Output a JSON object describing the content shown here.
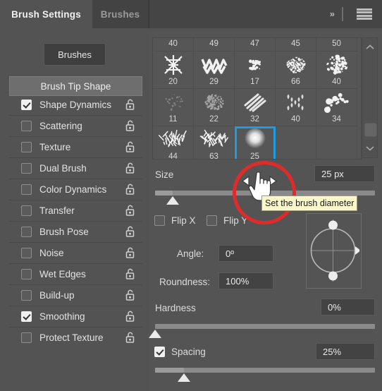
{
  "window": {
    "tabs": [
      {
        "label": "Brush Settings",
        "active": true
      },
      {
        "label": "Brushes",
        "active": false
      }
    ],
    "expand_icon": "chevron-double-right-icon",
    "menu_icon": "hamburger-menu-icon"
  },
  "sidebar": {
    "brushes_button": "Brushes",
    "header": "Brush Tip Shape",
    "items": [
      {
        "label": "Shape Dynamics",
        "checked": true,
        "lock": "unlocked-icon"
      },
      {
        "label": "Scattering",
        "checked": false,
        "lock": "unlocked-icon"
      },
      {
        "label": "Texture",
        "checked": false,
        "lock": "unlocked-icon"
      },
      {
        "label": "Dual Brush",
        "checked": false,
        "lock": "unlocked-icon"
      },
      {
        "label": "Color Dynamics",
        "checked": false,
        "lock": "unlocked-icon"
      },
      {
        "label": "Transfer",
        "checked": false,
        "lock": "unlocked-icon"
      },
      {
        "label": "Brush Pose",
        "checked": false,
        "lock": "unlocked-icon"
      },
      {
        "label": "Noise",
        "checked": false,
        "lock": "unlocked-icon"
      },
      {
        "label": "Wet Edges",
        "checked": false,
        "lock": "unlocked-icon"
      },
      {
        "label": "Build-up",
        "checked": false,
        "lock": "unlocked-icon"
      },
      {
        "label": "Smoothing",
        "checked": true,
        "lock": "unlocked-icon"
      },
      {
        "label": "Protect Texture",
        "checked": false,
        "lock": "unlocked-icon"
      }
    ]
  },
  "brush_grid": {
    "rows": [
      {
        "partial": true,
        "cells": [
          {
            "size": "40"
          },
          {
            "size": "49"
          },
          {
            "size": "47"
          },
          {
            "size": "45"
          },
          {
            "size": "50"
          }
        ]
      },
      {
        "partial": false,
        "cells": [
          {
            "size": "20",
            "thumb": "cross-hatch-star"
          },
          {
            "size": "29",
            "thumb": "zigzag-wave"
          },
          {
            "size": "17",
            "thumb": "small-speckle"
          },
          {
            "size": "66",
            "thumb": "fine-spatter"
          },
          {
            "size": "40",
            "thumb": "coarse-spatter"
          }
        ]
      },
      {
        "partial": false,
        "cells": [
          {
            "size": "11",
            "thumb": "faint-smudge"
          },
          {
            "size": "22",
            "thumb": "faint-spatter"
          },
          {
            "size": "32",
            "thumb": "diagonal-strokes"
          },
          {
            "size": "40",
            "thumb": "floral-scatter"
          },
          {
            "size": "34",
            "thumb": "dot-cluster"
          }
        ]
      },
      {
        "partial": false,
        "cells": [
          {
            "size": "44",
            "thumb": "grass-clump"
          },
          {
            "size": "63",
            "thumb": "grass-clump-wide"
          },
          {
            "size": "25",
            "thumb": "soft-round",
            "selected": true
          },
          {
            "size": "",
            "thumb": "",
            "empty": true
          },
          {
            "size": "",
            "thumb": "",
            "empty": true
          }
        ]
      }
    ],
    "scrollbar": {
      "up_icon": "chevron-up-icon",
      "down_icon": "chevron-down-icon"
    }
  },
  "controls": {
    "size_label": "Size",
    "size_value": "25 px",
    "size_percent": 8,
    "flip_x_label": "Flip X",
    "flip_x_checked": false,
    "flip_y_label": "Flip Y",
    "flip_y_checked": false,
    "angle_label": "Angle:",
    "angle_value": "0º",
    "roundness_label": "Roundness:",
    "roundness_value": "100%",
    "hardness_label": "Hardness",
    "hardness_value": "0%",
    "hardness_percent": 0,
    "spacing_label": "Spacing",
    "spacing_checked": true,
    "spacing_value": "25%",
    "spacing_percent": 13
  },
  "tooltip": {
    "text": "Set the brush diameter"
  },
  "annotation": {
    "shape": "red-circle-highlight",
    "color": "#e02b2b"
  },
  "cursor": {
    "type": "scrubby-slider-hand-cursor"
  },
  "colors": {
    "panel_bg": "#535353",
    "tab_bg": "#454545",
    "accent_selection": "#1f9ae4",
    "tooltip_bg": "#fbf7cd",
    "annotation_red": "#e02b2b"
  }
}
